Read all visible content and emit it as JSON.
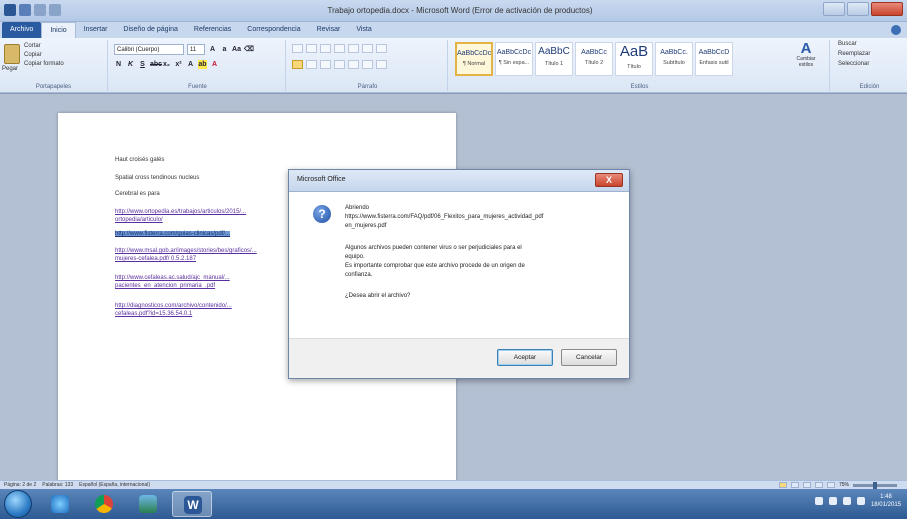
{
  "window": {
    "title": "Trabajo ortopedia.docx - Microsoft Word (Error de activación de productos)"
  },
  "tabs": [
    "Archivo",
    "Inicio",
    "Insertar",
    "Diseño de página",
    "Referencias",
    "Correspondencia",
    "Revisar",
    "Vista"
  ],
  "ribbon": {
    "clipboard": {
      "label": "Portapapeles",
      "paste": "Pegar",
      "cut": "Cortar",
      "copy": "Copiar",
      "format_painter": "Copiar formato"
    },
    "font": {
      "label": "Fuente",
      "family": "Calibri (Cuerpo)",
      "size": "11"
    },
    "paragraph": {
      "label": "Párrafo"
    },
    "styles": {
      "label": "Estilos",
      "items": [
        {
          "sample": "AaBbCcDc",
          "name": "¶ Normal"
        },
        {
          "sample": "AaBbCcDc",
          "name": "¶ Sin espa..."
        },
        {
          "sample": "AaBbC",
          "name": "Título 1"
        },
        {
          "sample": "AaBbCc",
          "name": "Título 2"
        },
        {
          "sample": "AaB",
          "name": "Título"
        },
        {
          "sample": "AaBbCc.",
          "name": "Subtítulo"
        },
        {
          "sample": "AaBbCcD",
          "name": "Énfasis sutil"
        }
      ],
      "change_styles": "Cambiar estilos"
    },
    "editing": {
      "label": "Edición",
      "find": "Buscar",
      "replace": "Reemplazar",
      "select": "Seleccionar"
    }
  },
  "document": {
    "lines": [
      "Haut croisés galés",
      "Spatial cross tendinous nucleus",
      "Cerebral es para"
    ],
    "links": [
      "http://www.ortopedia.es/trabajos/articulos/2015/...",
      "ortopedia/articulo/",
      "http://www.fisterra.com/guias-clinicas/pdf/...",
      "http://www.msal.gob.ar/images/stories/bes/graficos/...",
      "mujeres-cefalea.pdf/ 0.5.2.187",
      "http://www.cefaleas.ac.salud/ajc_manual/...",
      "pacientes_en_atencion_primaria_.pdf",
      "http://diagnosticos.com/archivo/contenido/...",
      "cefaleas.pdf?id=15.36.54.0.1"
    ]
  },
  "dialog": {
    "title": "Microsoft Office",
    "close": "X",
    "icon": "?",
    "line1": "Abriendo",
    "line2": "https://www.fisterra.com/FAQ/pdf/06_Flexitos_para_mujeres_actividad_pdf",
    "line3": "en_mujeres.pdf",
    "line4": "Algunos archivos pueden contener virus o ser perjudiciales para el",
    "line5": "equipo.",
    "line6": "Es importante comprobar que este archivo procede de un origen de",
    "line7": "confianza.",
    "line8": "¿Desea abrir el archivo?",
    "accept": "Aceptar",
    "cancel": "Cancelar"
  },
  "status": {
    "page": "Página: 2 de 2",
    "words": "Palabras: 133",
    "language": "Español (España, internacional)",
    "zoom": "75%"
  },
  "taskbar": {
    "time": "1:48",
    "date": "18/01/2015"
  }
}
